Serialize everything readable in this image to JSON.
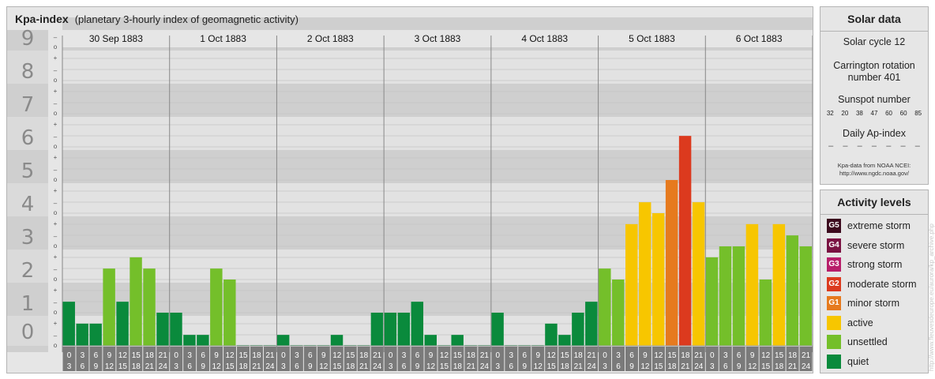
{
  "title": {
    "main": "Kpa-index",
    "sub": "(planetary 3-hourly index of geomagnetic activity)"
  },
  "chart_data": {
    "type": "bar",
    "y_major_ticks": [
      "0",
      "1",
      "2",
      "3",
      "4",
      "5",
      "6",
      "7",
      "8",
      "9"
    ],
    "y_minor_labels": [
      "+",
      "o",
      "–"
    ],
    "ylim": [
      0,
      9.33
    ],
    "grid": true,
    "days": [
      {
        "date": "30 Sep 1883",
        "values": [
          1.33,
          0.67,
          0.67,
          2.33,
          1.33,
          2.67,
          2.33,
          1.0
        ]
      },
      {
        "date": "1 Oct 1883",
        "values": [
          1.0,
          0.33,
          0.33,
          2.33,
          2.0,
          0,
          0,
          0
        ]
      },
      {
        "date": "2 Oct 1883",
        "values": [
          0.33,
          0,
          0,
          0,
          0.33,
          0,
          0,
          1.0
        ]
      },
      {
        "date": "3 Oct 1883",
        "values": [
          1.0,
          1.0,
          1.33,
          0.33,
          0,
          0.33,
          0,
          0
        ]
      },
      {
        "date": "4 Oct 1883",
        "values": [
          1.0,
          0,
          0,
          0,
          0.67,
          0.33,
          1.0,
          1.33
        ]
      },
      {
        "date": "5 Oct 1883",
        "values": [
          2.33,
          2.0,
          3.67,
          4.33,
          4.0,
          5.0,
          6.33,
          4.33
        ]
      },
      {
        "date": "6 Oct 1883",
        "values": [
          2.67,
          3.0,
          3.0,
          3.67,
          2.0,
          3.67,
          3.33,
          3.0
        ]
      }
    ],
    "hour_ranges": [
      [
        "0",
        "3"
      ],
      [
        "3",
        "6"
      ],
      [
        "6",
        "9"
      ],
      [
        "9",
        "12"
      ],
      [
        "12",
        "15"
      ],
      [
        "15",
        "18"
      ],
      [
        "18",
        "21"
      ],
      [
        "21",
        "24"
      ]
    ],
    "level_colors": {
      "quiet": "#0a8a3c",
      "unsettled": "#74bf2a",
      "active": "#f7c600",
      "minor": "#e67a1e",
      "moderate": "#dc3a1e",
      "strong": "#b81e6a",
      "severe": "#7a1242",
      "extreme": "#3c0a1e"
    }
  },
  "solar": {
    "header": "Solar data",
    "cycle": "Solar cycle 12",
    "rotation_line1": "Carrington rotation",
    "rotation_line2": "number 401",
    "sunspot_label": "Sunspot number",
    "sunspot_values": [
      "32",
      "20",
      "38",
      "47",
      "60",
      "60",
      "85"
    ],
    "ap_label": "Daily Ap-index",
    "ap_values": [
      "–",
      "–",
      "–",
      "–",
      "–",
      "–",
      "–"
    ],
    "source_line1": "Kpa-data from NOAA NCEI:",
    "source_line2": "http://www.ngdc.noaa.gov/"
  },
  "activity": {
    "header": "Activity levels",
    "items": [
      {
        "code": "G5",
        "label": "extreme storm",
        "color": "#3c0a1e"
      },
      {
        "code": "G4",
        "label": "severe storm",
        "color": "#7a1242"
      },
      {
        "code": "G3",
        "label": "strong storm",
        "color": "#b81e6a"
      },
      {
        "code": "G2",
        "label": "moderate storm",
        "color": "#dc3a1e"
      },
      {
        "code": "G1",
        "label": "minor storm",
        "color": "#e67a1e"
      },
      {
        "code": "",
        "label": "active",
        "color": "#f7c600"
      },
      {
        "code": "",
        "label": "unsettled",
        "color": "#74bf2a"
      },
      {
        "code": "",
        "label": "quiet",
        "color": "#0a8a3c"
      }
    ]
  },
  "watermark": "http://www.fleuvesdeurope.eu/aurora/kp_archive.php"
}
